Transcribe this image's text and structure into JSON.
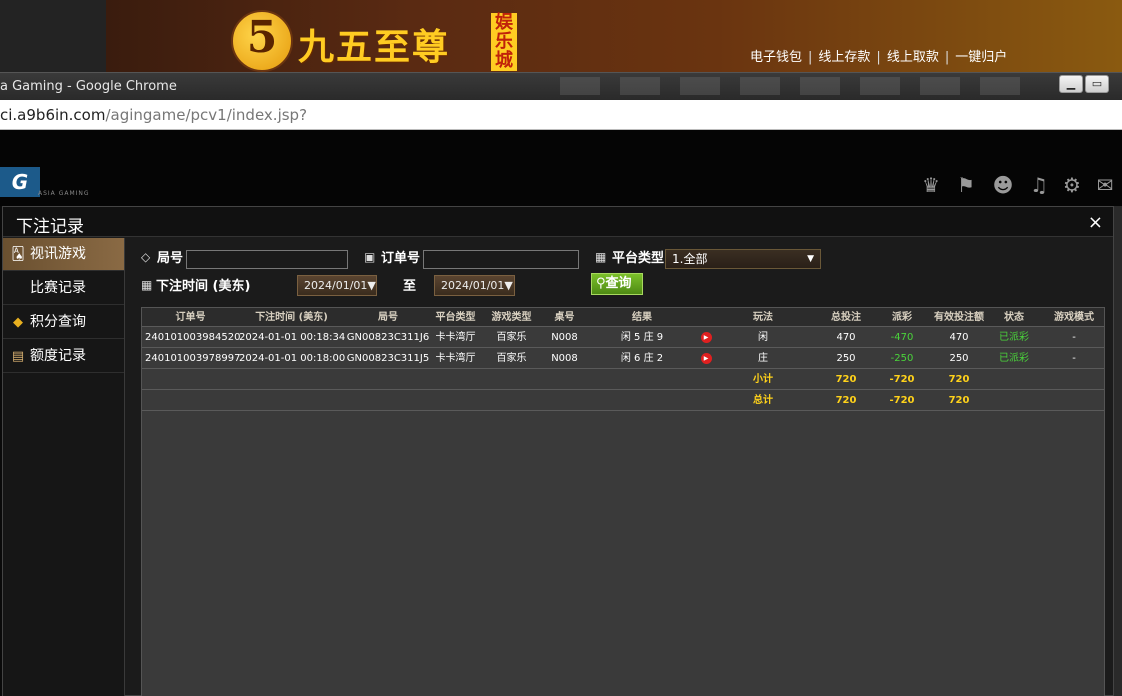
{
  "site": {
    "logo_digit": "5",
    "logo_text": "九五至尊",
    "logo_badge": "娱乐城",
    "nav": [
      "电子钱包",
      "线上存款",
      "线上取款",
      "一键归户"
    ]
  },
  "browser": {
    "window_title": "a Gaming - Google Chrome",
    "url_host": "ci.a9b6in.com",
    "url_path": "/agingame/pcv1/index.jsp?"
  },
  "game": {
    "logo_text": "G",
    "logo_sub": "ASIA GAMING"
  },
  "dialog": {
    "title": "下注记录",
    "close": "×"
  },
  "leftnav": [
    {
      "label": "视讯游戏",
      "icon": "cards-icon",
      "active": true
    },
    {
      "label": "比赛记录",
      "icon": "",
      "active": false
    },
    {
      "label": "积分查询",
      "icon": "diamond-icon",
      "active": false
    },
    {
      "label": "额度记录",
      "icon": "document-icon",
      "active": false
    }
  ],
  "filters": {
    "round_label": "局号",
    "round_value": "",
    "order_label": "订单号",
    "order_value": "",
    "platform_label": "平台类型",
    "platform_value": "1.全部",
    "time_label": "下注时间 (美东)",
    "date_from": "2024/01/01▼",
    "to_label": "至",
    "date_to": "2024/01/01▼",
    "query_button": "查询"
  },
  "table": {
    "headers": [
      "订单号",
      "下注时间 (美东)",
      "局号",
      "平台类型",
      "游戏类型",
      "桌号",
      "结果",
      "玩法",
      "总投注",
      "派彩",
      "有效投注额",
      "状态",
      "游戏模式"
    ],
    "rows": [
      {
        "order": "240101003984520",
        "time": "2024-01-01 00:18:34",
        "round": "GN00823C311J6",
        "platform": "卡卡湾厅",
        "game": "百家乐",
        "table_no": "N008",
        "result": "闲 5 庄 9",
        "play": "闲",
        "bet": "470",
        "payout": "-470",
        "valid": "470",
        "status": "已派彩",
        "mode": "-"
      },
      {
        "order": "240101003978997",
        "time": "2024-01-01 00:18:00",
        "round": "GN00823C311J5",
        "platform": "卡卡湾厅",
        "game": "百家乐",
        "table_no": "N008",
        "result": "闲 6 庄 2",
        "play": "庄",
        "bet": "250",
        "payout": "-250",
        "valid": "250",
        "status": "已派彩",
        "mode": "-"
      }
    ],
    "subtotal": {
      "label": "小计",
      "bet": "720",
      "payout": "-720",
      "valid": "720"
    },
    "total": {
      "label": "总计",
      "bet": "720",
      "payout": "-720",
      "valid": "720"
    }
  },
  "colors": {
    "accent_green": "#4ad43a",
    "accent_yellow": "#ffd21a",
    "query_green": "#6aae22"
  }
}
